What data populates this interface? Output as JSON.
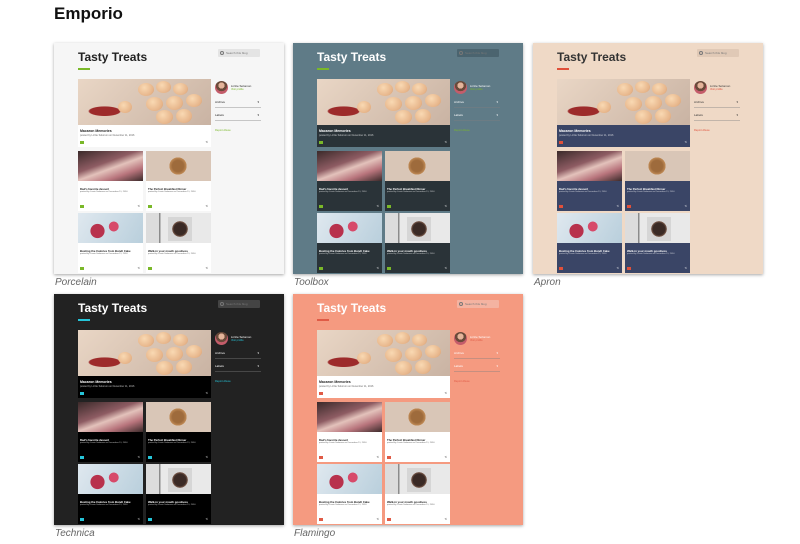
{
  "page": {
    "title": "Emporio"
  },
  "preview_text": {
    "blog_title": "Tasty Treats",
    "search_placeholder": "Search this blog",
    "hero_post_title": "Macaron Memories",
    "hero_post_sub": "posted by Lizzie Solomon on December 11, 2016",
    "posts": [
      {
        "title": "Dad's favorite dessert",
        "sub": "posted by Lizzie Solomon on December 11, 2016"
      },
      {
        "title": "The Perfect Breakfast Dinner",
        "sub": "posted by Lizzie Solomon on December 11, 2016"
      },
      {
        "title": "Busting the Calories from Bundt Cake",
        "sub": "posted by Lizzie Solomon on December 11, 2016"
      },
      {
        "title": "Walk-in your mouth goodness",
        "sub": "posted by Lizzie Solomon on December 11, 2016"
      }
    ],
    "profile_name": "Lizzie Solomon",
    "profile_link": "Visit profile",
    "archive_label": "Archive",
    "labels_label": "Labels",
    "report_label": "Report Abuse"
  },
  "themes": [
    {
      "name": "Porcelain",
      "bg": "#f6f6f6",
      "text": "#222222",
      "card": "#ffffff",
      "search": "#e4e4e4",
      "accent": "#7ab829"
    },
    {
      "name": "Toolbox",
      "bg": "#5f7b87",
      "text": "#ffffff",
      "card": "#2a3338",
      "search": "#4b646f",
      "accent": "#7ab829"
    },
    {
      "name": "Apron",
      "bg": "#efd9c6",
      "text": "#333333",
      "card": "#3a4566",
      "search": "#e0c9b6",
      "accent": "#e0503a"
    },
    {
      "name": "Technica",
      "bg": "#222222",
      "text": "#ffffff",
      "card": "#000000",
      "search": "#444444",
      "accent": "#26c4d8"
    },
    {
      "name": "Flamingo",
      "bg": "#f59a80",
      "text": "#ffffff",
      "card": "#ffffff",
      "search": "#f4b3a1",
      "accent": "#e05b46"
    }
  ]
}
